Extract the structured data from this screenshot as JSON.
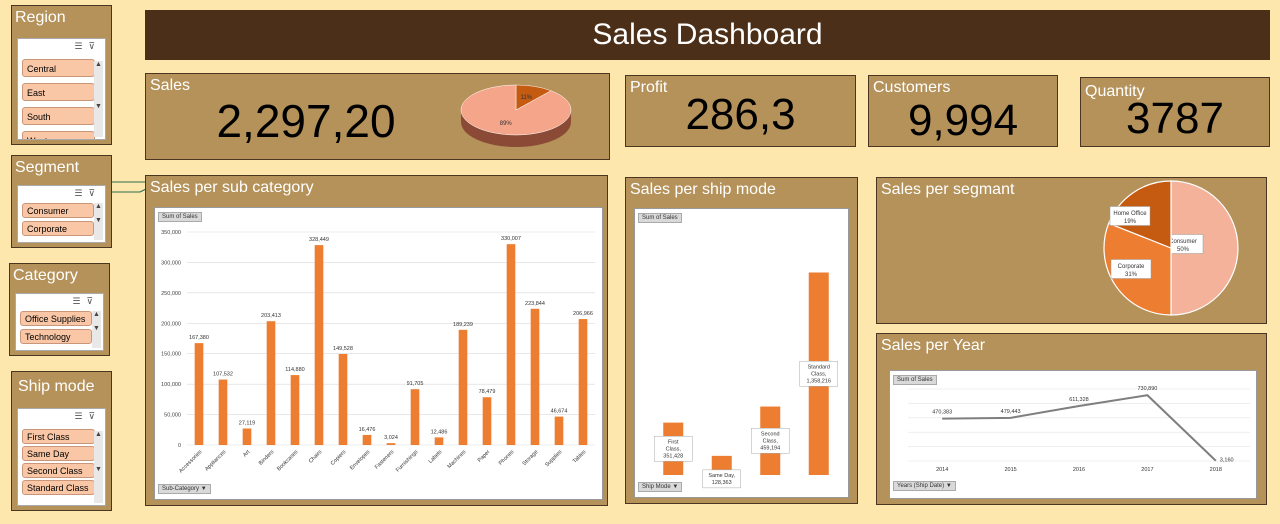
{
  "header": {
    "title": "Sales Dashboard"
  },
  "kpis": {
    "sales": {
      "label": "Sales",
      "value": "2,297,20"
    },
    "profit": {
      "label": "Profit",
      "value": "286,3"
    },
    "customers": {
      "label": "Customers",
      "value": "9,994"
    },
    "quantity": {
      "label": "Quantity",
      "value": "3787"
    }
  },
  "slicers": {
    "region": {
      "title": "Region",
      "items": [
        "Central",
        "East",
        "South",
        "West"
      ]
    },
    "segment": {
      "title": "Segment",
      "items": [
        "Consumer",
        "Corporate"
      ]
    },
    "category": {
      "title": "Category",
      "items": [
        "Office Supplies",
        "Technology"
      ]
    },
    "ship_mode": {
      "title": "Ship mode",
      "items": [
        "First Class",
        "Same Day",
        "Second Class",
        "Standard Class"
      ]
    }
  },
  "colors": {
    "bar": "#ed7d31",
    "panel": "#b5925a",
    "header": "#4b2f18",
    "background": "#fde7ad"
  },
  "panels": {
    "subcat": {
      "title": "Sales per sub category",
      "field_button": "Sum of Sales",
      "axis_button": "Sub-Category"
    },
    "shipmode": {
      "title": "Sales per ship mode",
      "field_button": "Sum of Sales",
      "axis_button": "Ship Mode"
    },
    "segment": {
      "title": "Sales per segmant"
    },
    "year": {
      "title": "Sales per Year",
      "field_button": "Sum of Sales",
      "axis_button": "Years (Ship Date)"
    }
  },
  "chart_data": [
    {
      "id": "kpi-pie",
      "type": "pie",
      "labels": [
        "11%",
        "89%"
      ],
      "values": [
        11,
        89
      ],
      "colors": [
        "#c55a11",
        "#f4a58a"
      ]
    },
    {
      "id": "subcat",
      "type": "bar",
      "categories": [
        "Accessories",
        "Appliances",
        "Art",
        "Binders",
        "Bookcases",
        "Chairs",
        "Copiers",
        "Envelopes",
        "Fasteners",
        "Furnishings",
        "Labels",
        "Machines",
        "Paper",
        "Phones",
        "Storage",
        "Supplies",
        "Tables"
      ],
      "values": [
        167380,
        107532,
        27119,
        203413,
        114880,
        328449,
        149528,
        16476,
        3024,
        91705,
        12486,
        189239,
        78479,
        330007,
        223844,
        46674,
        206966
      ],
      "value_labels": [
        "167,380",
        "107,532",
        "27,119",
        "203,413",
        "114,880",
        "328,449",
        "149,528",
        "16,476",
        "3,024",
        "91,705",
        "12,486",
        "189,239",
        "78,479",
        "330,007",
        "223,844",
        "46,674",
        "206,966"
      ],
      "ylim": [
        0,
        350000
      ],
      "yticks": [
        0,
        50000,
        100000,
        150000,
        200000,
        250000,
        300000,
        350000
      ],
      "ytick_labels": [
        "0",
        "50,000",
        "100,000",
        "150,000",
        "200,000",
        "250,000",
        "300,000",
        "350,000"
      ],
      "grid": true
    },
    {
      "id": "shipmode",
      "type": "bar",
      "categories": [
        "First Class",
        "Same Day",
        "Second Class",
        "Standard Class"
      ],
      "values": [
        351428,
        128363,
        459194,
        1358216
      ],
      "value_labels": [
        "First Class, 351,428",
        "Same Day, 128,363",
        "Second Class, 459,194",
        "Standard Class, 1,358,216"
      ],
      "ylim": [
        0,
        1650000
      ]
    },
    {
      "id": "segment",
      "type": "pie",
      "labels": [
        "Consumer",
        "Corporate",
        "Home Office"
      ],
      "percent_labels": [
        "50%",
        "31%",
        "19%"
      ],
      "values": [
        50,
        31,
        19
      ],
      "colors": [
        "#f4b29b",
        "#ed7d31",
        "#c55a11"
      ]
    },
    {
      "id": "year",
      "type": "line",
      "x": [
        "2014",
        "2015",
        "2016",
        "2017",
        "2018"
      ],
      "y": [
        470383,
        479443,
        611328,
        730890,
        3160
      ],
      "value_labels": [
        "470,383",
        "479,443",
        "611,328",
        "730,890",
        "3,160"
      ],
      "ylim": [
        0,
        800000
      ],
      "grid": true
    }
  ]
}
